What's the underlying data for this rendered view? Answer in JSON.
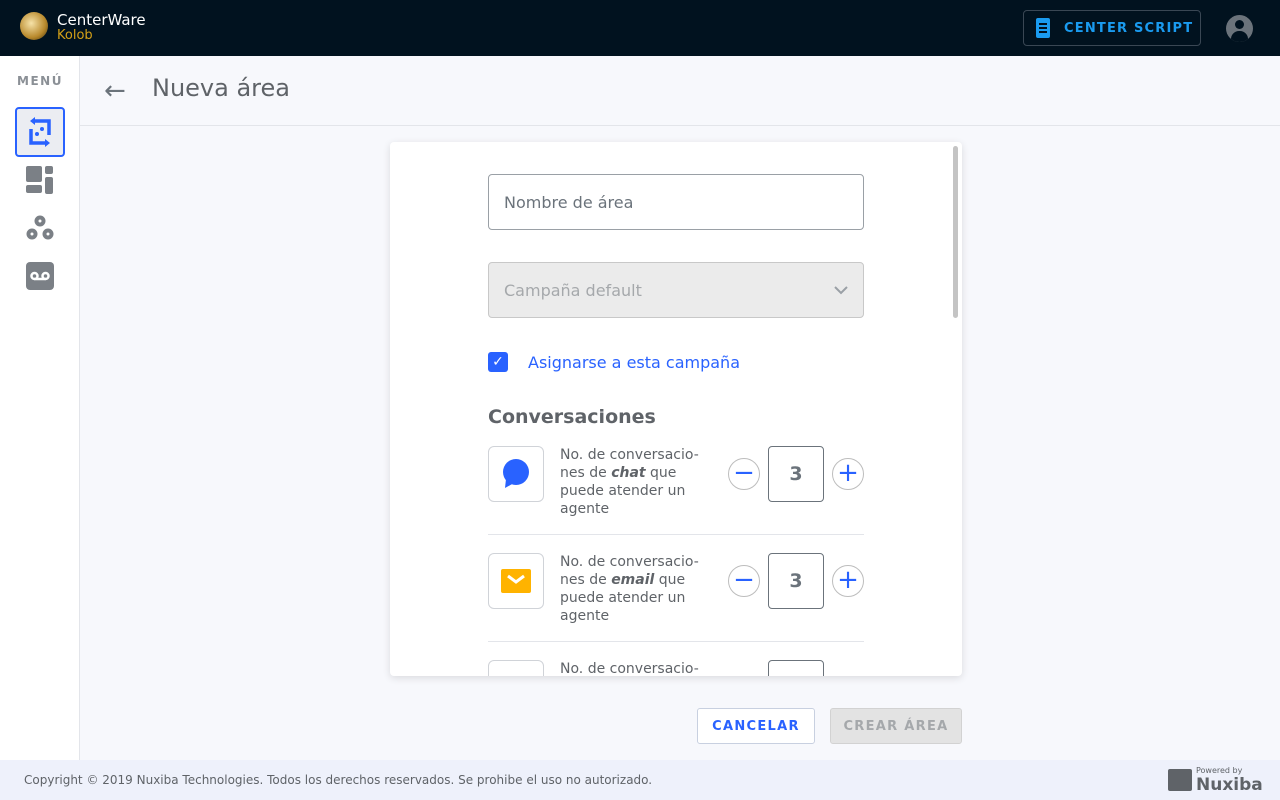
{
  "header": {
    "brand_name": "CenterWare",
    "brand_sub": "Kolob",
    "center_script_label": "CENTER SCRIPT"
  },
  "sidebar": {
    "menu_label": "MENÚ",
    "items": [
      {
        "icon": "areas-icon",
        "active": true
      },
      {
        "icon": "dashboard-icon"
      },
      {
        "icon": "groups-icon"
      },
      {
        "icon": "voicemail-icon"
      }
    ]
  },
  "page": {
    "title": "Nueva área"
  },
  "form": {
    "area_name_placeholder": "Nombre de área",
    "campaign_placeholder": "Campaña default",
    "assign_label": "Asignarse a esta campaña",
    "assign_checked": true,
    "section_title": "Conversaciones",
    "rows": [
      {
        "icon": "chat-icon",
        "pre": "No. de conversacio-nes de ",
        "channel": "chat",
        "post": " que puede atender un agente",
        "value": "3"
      },
      {
        "icon": "email-icon",
        "pre": "No. de conversacio-nes de ",
        "channel": "email",
        "post": " que puede atender un agente",
        "value": "3"
      },
      {
        "pre": "No. de conversacio-",
        "value": ""
      }
    ]
  },
  "actions": {
    "cancel": "CANCELAR",
    "create": "CREAR ÁREA"
  },
  "footer": {
    "copyright": "Copyright © 2019 Nuxiba Technologies. Todos los derechos reservados. Se prohibe el uso no autorizado.",
    "powered": "Powered by",
    "company": "Nuxiba"
  },
  "colors": {
    "accent": "#2962ff",
    "header_bg": "#01121f",
    "script_blue": "#1a9bf0",
    "email_yellow": "#ffb300"
  }
}
